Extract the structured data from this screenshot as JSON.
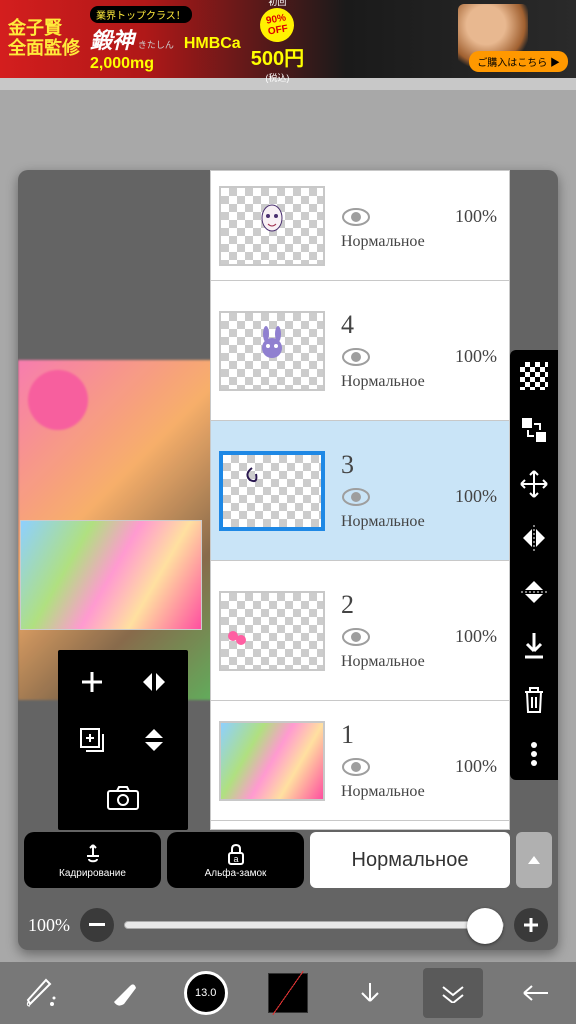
{
  "ad": {
    "left1": "金子賢",
    "left2": "全面監修",
    "tag": "業界トップクラス！",
    "brand": "鍛神",
    "sub": "きたしん",
    "hmb": "HMBCa",
    "mg": "2,000mg",
    "first": "初回",
    "off": "90% OFF",
    "price": "500円",
    "tax": "(税込)",
    "buy": "ご購入はこちら ▶"
  },
  "layers": [
    {
      "num": "",
      "opacity": "100%",
      "blend": "Нормальное",
      "selected": false,
      "thumb": "face"
    },
    {
      "num": "4",
      "opacity": "100%",
      "blend": "Нормальное",
      "selected": false,
      "thumb": "bunny"
    },
    {
      "num": "3",
      "opacity": "100%",
      "blend": "Нормальное",
      "selected": true,
      "thumb": "swirl"
    },
    {
      "num": "2",
      "opacity": "100%",
      "blend": "Нормальное",
      "selected": false,
      "thumb": "pink"
    },
    {
      "num": "1",
      "opacity": "100%",
      "blend": "Нормальное",
      "selected": false,
      "thumb": "photo"
    }
  ],
  "actions": {
    "crop": "Кадрирование",
    "alpha": "Альфа-замок",
    "blend": "Нормальное"
  },
  "opacity": {
    "label": "100%"
  },
  "brush": {
    "size": "13.0"
  }
}
